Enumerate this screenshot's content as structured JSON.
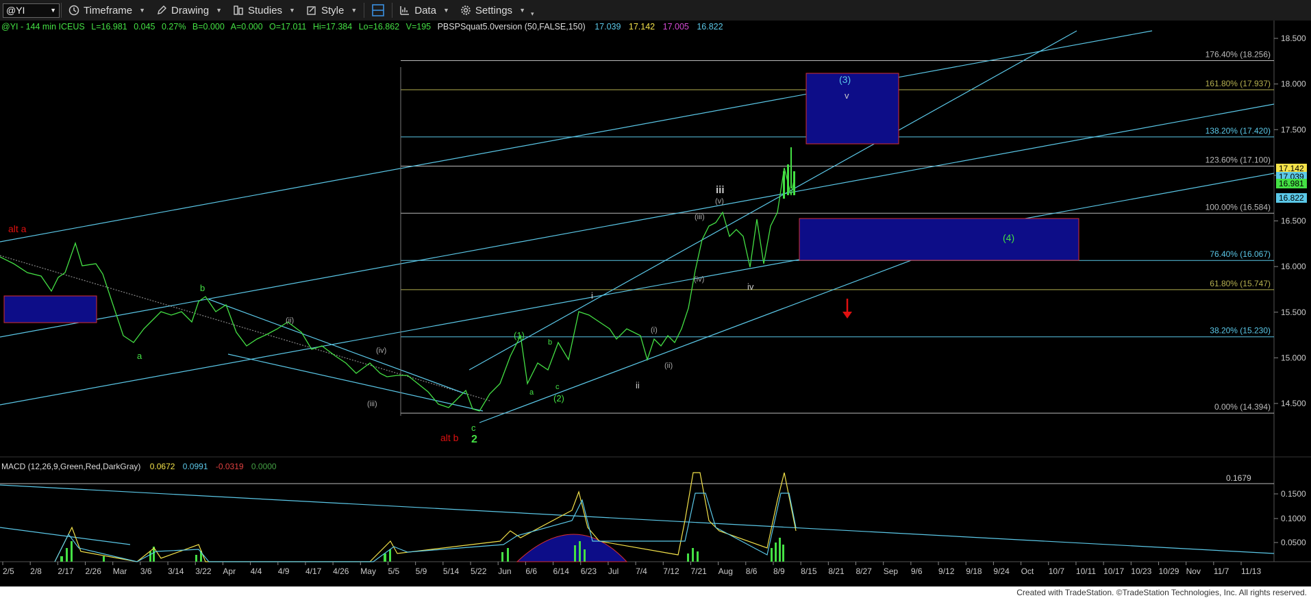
{
  "toolbar": {
    "symbol": "@YI",
    "timeframe": "Timeframe",
    "drawing": "Drawing",
    "studies": "Studies",
    "style": "Style",
    "data": "Data",
    "settings": "Settings"
  },
  "header": {
    "symbol_info": "@YI - 144 min  ICEUS",
    "last": "L=16.981",
    "change": "0.045",
    "change_pct": "0.27%",
    "bid": "B=0.000",
    "ask": "A=0.000",
    "open": "O=17.011",
    "high": "Hi=17.384",
    "low": "Lo=16.862",
    "volume": "V=195",
    "study": "PBSPSquat5.0version (50,FALSE,150)",
    "study_values": [
      "17.039",
      "17.142",
      "17.005",
      "16.822"
    ],
    "study_colors": [
      "#5bc8e8",
      "#f3e24a",
      "#d24ad2",
      "#5bc8e8"
    ]
  },
  "price_axis": {
    "ticks": [
      "18.500",
      "18.000",
      "17.500",
      "17.000",
      "16.500",
      "16.000",
      "15.500",
      "15.000",
      "14.500"
    ],
    "badges": [
      {
        "text": "17.142",
        "bg": "#f3e24a",
        "fg": "#000"
      },
      {
        "text": "17.039",
        "bg": "#5bc8e8",
        "fg": "#000"
      },
      {
        "text": "16.981",
        "bg": "#44e044",
        "fg": "#000"
      },
      {
        "text": "16.822",
        "bg": "#5bc8e8",
        "fg": "#000"
      }
    ]
  },
  "fib_levels": [
    {
      "label": "176.40% (18.256)",
      "value": 18.256,
      "color": "#bbbbbb"
    },
    {
      "label": "161.80% (17.937)",
      "value": 17.937,
      "color": "#b5b050"
    },
    {
      "label": "138.20% (17.420)",
      "value": 17.42,
      "color": "#5bc8e8"
    },
    {
      "label": "123.60% (17.100)",
      "value": 17.1,
      "color": "#bbbbbb"
    },
    {
      "label": "100.00% (16.584)",
      "value": 16.584,
      "color": "#bbbbbb"
    },
    {
      "label": "76.40% (16.067)",
      "value": 16.067,
      "color": "#5bc8e8"
    },
    {
      "label": "61.80% (15.747)",
      "value": 15.747,
      "color": "#b5b050"
    },
    {
      "label": "38.20% (15.230)",
      "value": 15.23,
      "color": "#5bc8e8"
    },
    {
      "label": "0.00% (14.394)",
      "value": 14.394,
      "color": "#bbbbbb"
    }
  ],
  "wave_labels": {
    "alt_a": "alt a",
    "alt_b": "alt b",
    "a1": "a",
    "b1": "b",
    "c1": "c",
    "two": "2",
    "ii_sub": "(ii)",
    "iii_sub": "(iii)",
    "iv_sub": "(iv)",
    "one_g": "(1)",
    "two_g": "(2)",
    "three_t": "(3)",
    "four_g": "(4)",
    "a2": "a",
    "b2": "b",
    "c2": "c",
    "i": "i",
    "ii": "ii",
    "i_sub": "(i)",
    "ii_sub2": "(ii)",
    "iii_sub2": "(iii)",
    "iv_sub2": "(iv)",
    "v_sub": "(v)",
    "iii": "iii",
    "iv": "iv",
    "v": "v"
  },
  "macd": {
    "title": "MACD (12,26,9,Green,Red,DarkGray)",
    "values": [
      "0.0672",
      "0.0991",
      "-0.0319",
      "0.0000"
    ],
    "value_colors": [
      "#f3e24a",
      "#5bc8e8",
      "#e04040",
      "#44a044"
    ],
    "ticks": [
      "0.1500",
      "0.1000",
      "0.0500"
    ],
    "hline": "0.1679"
  },
  "date_axis": [
    "2/5",
    "2/8",
    "2/17",
    "2/26",
    "Mar",
    "3/6",
    "3/14",
    "3/22",
    "Apr",
    "4/4",
    "4/9",
    "4/17",
    "4/26",
    "May",
    "5/5",
    "5/9",
    "5/14",
    "5/22",
    "Jun",
    "6/6",
    "6/14",
    "6/23",
    "Jul",
    "7/4",
    "7/12",
    "7/21",
    "Aug",
    "8/6",
    "8/9",
    "8/15",
    "8/21",
    "8/27",
    "Sep",
    "9/6",
    "9/12",
    "9/18",
    "9/24",
    "Oct",
    "10/7",
    "10/11",
    "10/17",
    "10/23",
    "10/29",
    "Nov",
    "11/7",
    "11/13"
  ],
  "footer": "Created with TradeStation. ©TradeStation Technologies, Inc. All rights reserved."
}
